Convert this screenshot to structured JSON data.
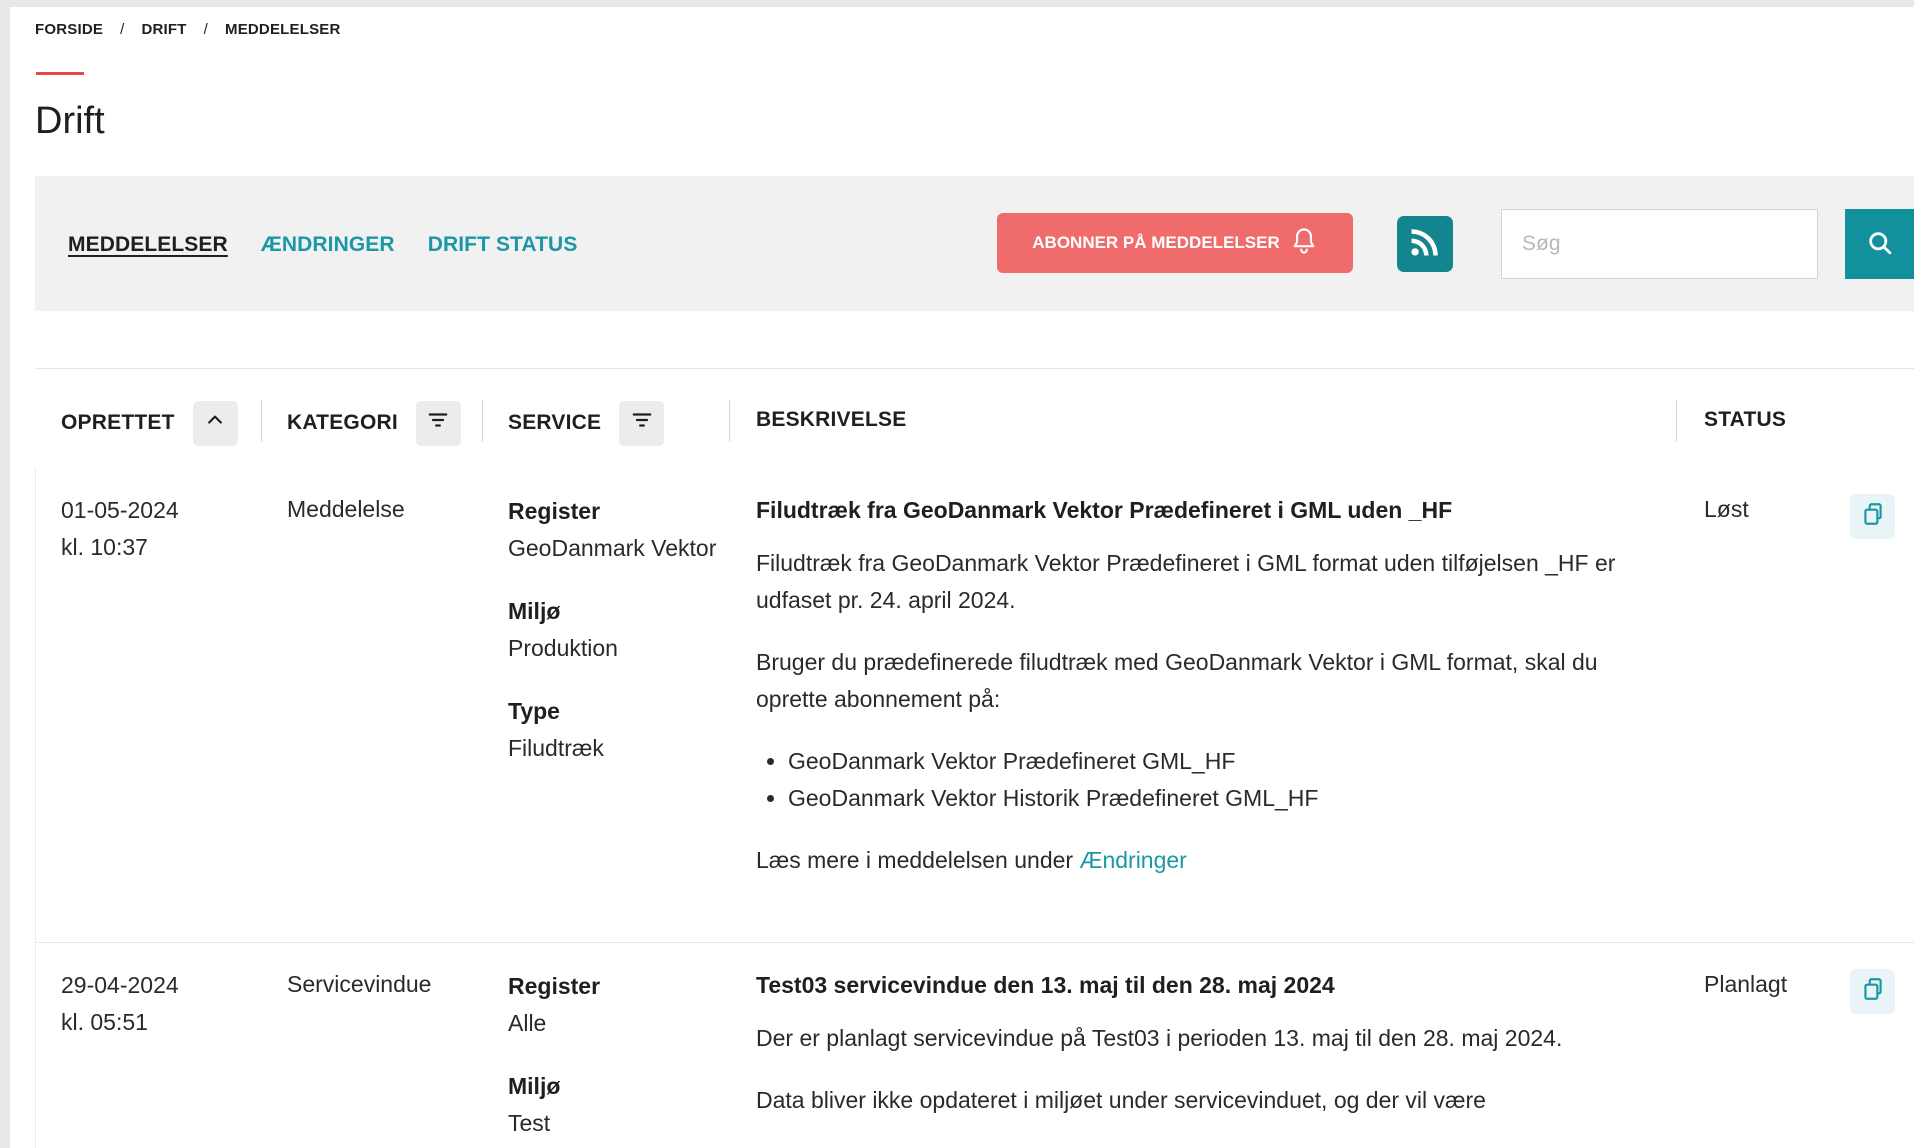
{
  "breadcrumb": {
    "items": [
      "FORSIDE",
      "DRIFT",
      "MEDDELELSER"
    ],
    "separator": "/"
  },
  "page_title": "Drift",
  "colors": {
    "accent": "#e8474b",
    "teal": "#1b97a5",
    "teal_dark": "#12858f",
    "subscribe": "#f06b6b"
  },
  "tabs": [
    {
      "label": "MEDDELELSER",
      "active": true
    },
    {
      "label": "ÆNDRINGER",
      "active": false
    },
    {
      "label": "DRIFT STATUS",
      "active": false
    }
  ],
  "subscribe_label": "ABONNER PÅ MEDDELELSER",
  "icons": {
    "subscribe": "bell-icon",
    "rss": "rss-icon",
    "search": "search-icon",
    "sort": "chevron-up-icon",
    "filter": "filter-icon",
    "copy": "copy-icon"
  },
  "search": {
    "placeholder": "Søg"
  },
  "table": {
    "headers": {
      "created": "OPRETTET",
      "category": "KATEGORI",
      "service": "SERVICE",
      "description": "BESKRIVELSE",
      "status": "STATUS"
    },
    "rows": [
      {
        "date": "01-05-2024",
        "time": "kl. 10:37",
        "category": "Meddelelse",
        "service": [
          {
            "label": "Register",
            "value": "GeoDanmark Vektor"
          },
          {
            "label": "Miljø",
            "value": "Produktion"
          },
          {
            "label": "Type",
            "value": "Filudtræk"
          }
        ],
        "title": "Filudtræk fra GeoDanmark Vektor Prædefineret i GML uden _HF",
        "paragraphs": [
          "Filudtræk fra GeoDanmark Vektor Prædefineret i GML format uden tilføjelsen _HF er udfaset pr. 24. april 2024.",
          "Bruger du prædefinerede filudtræk med GeoDanmark Vektor i GML format, skal du oprette abonnement på:"
        ],
        "bullets": [
          "GeoDanmark Vektor Prædefineret GML_HF",
          "GeoDanmark Vektor Historik Prædefineret GML_HF"
        ],
        "more_text": "Læs mere i meddelelsen under ",
        "more_link": "Ændringer",
        "status": "Løst"
      },
      {
        "date": "29-04-2024",
        "time": "kl. 05:51",
        "category": "Servicevindue",
        "service": [
          {
            "label": "Register",
            "value": "Alle"
          },
          {
            "label": "Miljø",
            "value": "Test"
          }
        ],
        "title": "Test03 servicevindue den 13. maj til den 28. maj 2024",
        "paragraphs": [
          "Der er planlagt servicevindue på Test03 i perioden 13. maj til den 28. maj 2024.",
          "Data bliver ikke opdateret i miljøet under servicevinduet, og der vil være"
        ],
        "status": "Planlagt"
      }
    ]
  }
}
